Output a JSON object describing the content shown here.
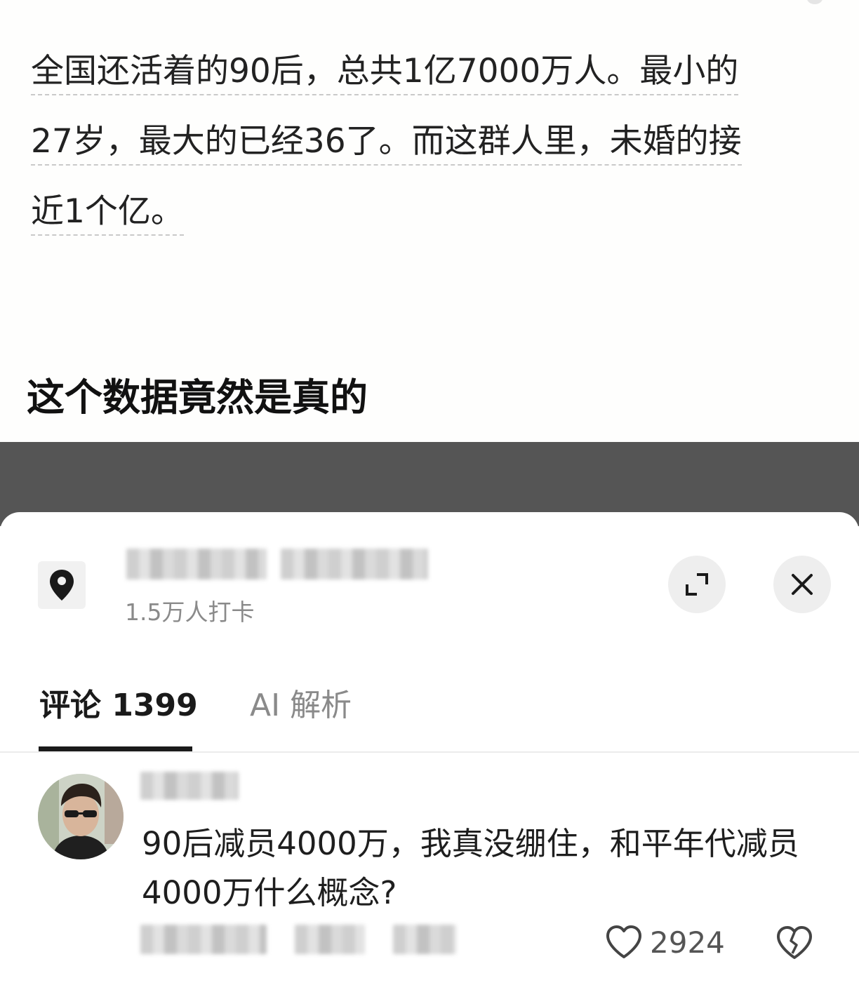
{
  "post": {
    "lines": [
      "全国还活着的90后，总共1亿7000万人。最小的",
      "27岁，最大的已经36了。而这群人里，未婚的接",
      "近1个亿。"
    ],
    "title": "这个数据竟然是真的"
  },
  "location": {
    "icon": "location-pin-icon",
    "checkins": "1.5万人打卡"
  },
  "tabs": {
    "comments": "评论 1399",
    "ai": "AI 解析"
  },
  "comment": {
    "text": "90后减员4000万，我真没绷住，和平年代减员4000万什么概念?",
    "likes": "2924"
  },
  "colors": {
    "accent": "#1a1a1a",
    "muted": "#8a8a8a",
    "overlay": "#555555"
  }
}
